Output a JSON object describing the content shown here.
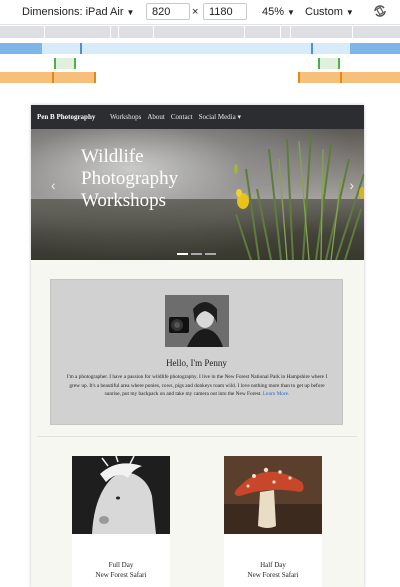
{
  "devtools": {
    "dimensions_label": "Dimensions: iPad Air",
    "width": "820",
    "height": "1180",
    "times": "×",
    "zoom": "45%",
    "throttle": "Custom"
  },
  "colors": {
    "mq_gray": "#dedfe2",
    "mq_blue": "#7fb6ea",
    "mq_green": "#4caf50",
    "mq_orange": "#f0a547",
    "navbar": "#2b2d30",
    "link": "#2b66c6"
  },
  "site": {
    "brand": "Pen B Photography",
    "nav": [
      "Workshops",
      "About",
      "Contact",
      "Social Media ▾"
    ],
    "hero_title": "Wildlife Photography Workshops",
    "intro_title": "Hello, I'm Penny",
    "intro_text": "I'm a photographer. I have a passion for wildlife photography. I live in the New Forest National Park in Hampshire where I grew up. It's a beautiful area where ponies, cows, pigs and donkeys roam wild. I love nothing more than to get up before sunrise, put my backpack on and take my camera out into the New Forest.",
    "learn_more": "Learn More.",
    "cards": [
      {
        "line1": "Full Day",
        "line2": "New Forest Safari"
      },
      {
        "line1": "Half Day",
        "line2": "New Forest Safari"
      }
    ]
  },
  "icons": {
    "rotate": "rotate-icon",
    "prev": "chevron-left-icon",
    "next": "chevron-right-icon"
  }
}
